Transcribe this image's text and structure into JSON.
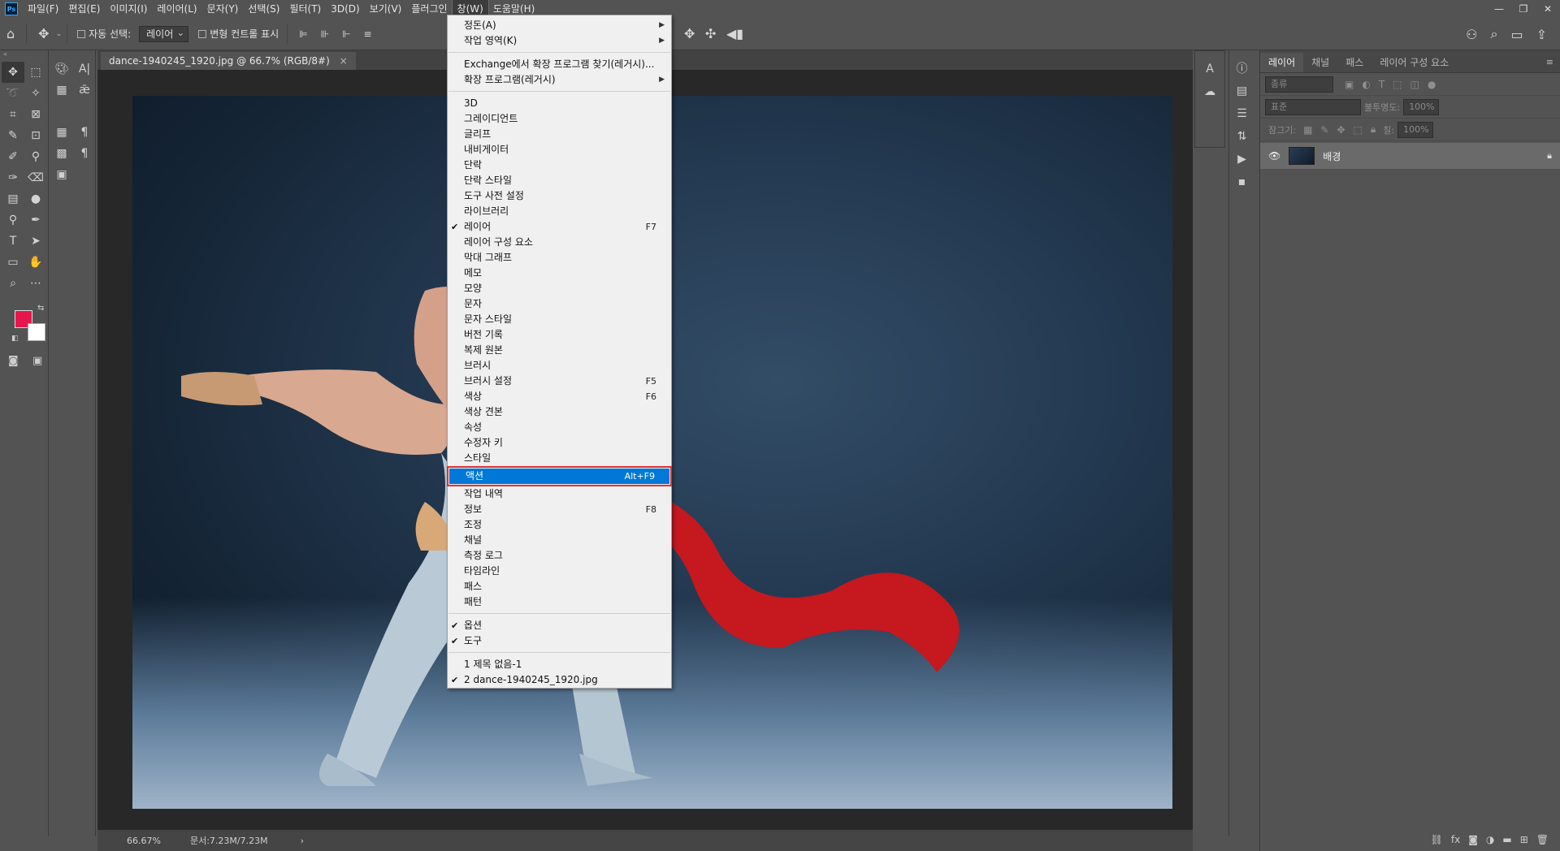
{
  "app": {
    "logo": "Ps",
    "menu": [
      "파일(F)",
      "편집(E)",
      "이미지(I)",
      "레이어(L)",
      "문자(Y)",
      "선택(S)",
      "필터(T)",
      "3D(D)",
      "보기(V)",
      "플러그인",
      "창(W)",
      "도움말(H)"
    ],
    "active_menu_index": 10
  },
  "optionsbar": {
    "auto_select_label": "자동 선택:",
    "auto_select_value": "레이어",
    "transform_controls_label": "변형 컨트롤 표시"
  },
  "document": {
    "tab_title": "dance-1940245_1920.jpg @ 66.7% (RGB/8#)",
    "zoom": "66.67%",
    "doc_size": "문서:7.23M/7.23M"
  },
  "colors": {
    "foreground": "#e8174b",
    "background": "#ffffff",
    "highlight": "#0078d7",
    "highlight_outline": "#e03030"
  },
  "layers_panel": {
    "tabs": [
      "레이어",
      "채널",
      "패스",
      "레이어 구성 요소"
    ],
    "search_placeholder": "종류",
    "blend_mode": "표준",
    "opacity_label": "불투명도:",
    "opacity_value": "100%",
    "lock_label": "잠그기:",
    "fill_label": "칠:",
    "fill_value": "100%",
    "layer_name": "배경"
  },
  "window_menu": {
    "groups": [
      [
        {
          "label": "정돈(A)",
          "submenu": true
        },
        {
          "label": "작업 영역(K)",
          "submenu": true
        }
      ],
      [
        {
          "label": "Exchange에서 확장 프로그램 찾기(레거시)..."
        },
        {
          "label": "확장 프로그램(레거시)",
          "submenu": true
        }
      ],
      [
        {
          "label": "3D"
        },
        {
          "label": "그레이디언트"
        },
        {
          "label": "글리프"
        },
        {
          "label": "내비게이터"
        },
        {
          "label": "단락"
        },
        {
          "label": "단락 스타일"
        },
        {
          "label": "도구 사전 설정"
        },
        {
          "label": "라이브러리"
        },
        {
          "label": "레이어",
          "checked": true,
          "shortcut": "F7"
        },
        {
          "label": "레이어 구성 요소"
        },
        {
          "label": "막대 그래프"
        },
        {
          "label": "메모"
        },
        {
          "label": "모양"
        },
        {
          "label": "문자"
        },
        {
          "label": "문자 스타일"
        },
        {
          "label": "버전 기록"
        },
        {
          "label": "복제 원본"
        },
        {
          "label": "브러시"
        },
        {
          "label": "브러시 설정",
          "shortcut": "F5"
        },
        {
          "label": "색상",
          "shortcut": "F6"
        },
        {
          "label": "색상 견본"
        },
        {
          "label": "속성"
        },
        {
          "label": "수정자 키"
        },
        {
          "label": "스타일"
        },
        {
          "label": "액션",
          "shortcut": "Alt+F9",
          "highlighted": true
        },
        {
          "label": "작업 내역"
        },
        {
          "label": "정보",
          "shortcut": "F8"
        },
        {
          "label": "조정"
        },
        {
          "label": "채널"
        },
        {
          "label": "측정 로그"
        },
        {
          "label": "타임라인"
        },
        {
          "label": "패스"
        },
        {
          "label": "패턴"
        }
      ],
      [
        {
          "label": "옵션",
          "checked": true
        },
        {
          "label": "도구",
          "checked": true
        }
      ],
      [
        {
          "label": "1 제목 없음-1"
        },
        {
          "label": "2 dance-1940245_1920.jpg",
          "checked": true
        }
      ]
    ]
  }
}
